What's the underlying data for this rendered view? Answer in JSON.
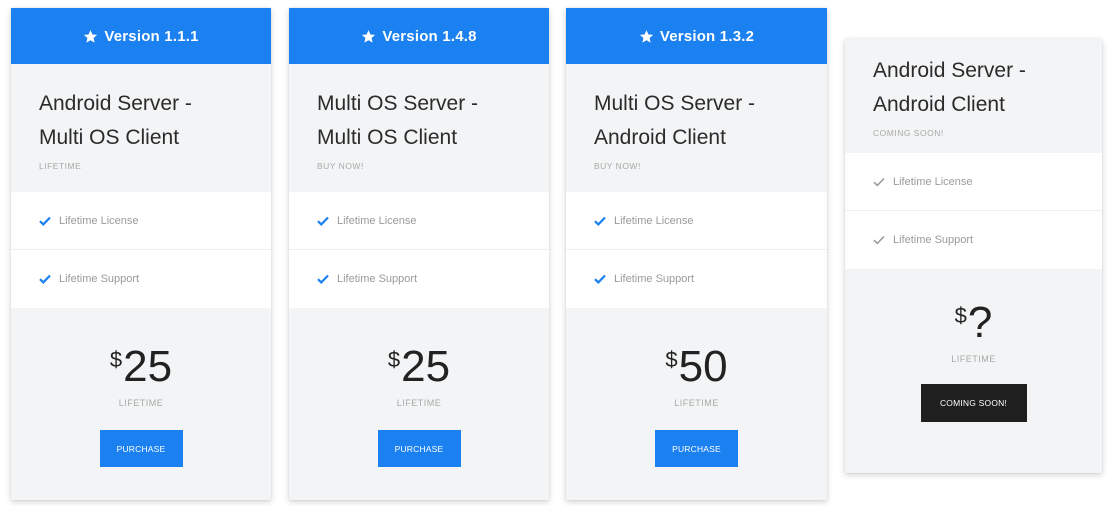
{
  "colors": {
    "accent": "#1b80f0",
    "dark_button": "#1f1f1f",
    "panel_bg": "#f3f4f5"
  },
  "icons": {
    "header_icon": "star-icon",
    "feature_icon": "check-icon"
  },
  "cards": [
    {
      "version": "Version 1.1.1",
      "title_line1": "Android Server -",
      "title_line2": "Multi OS Client",
      "subtitle": "LIFETIME",
      "features": [
        "Lifetime License",
        "Lifetime Support"
      ],
      "currency": "$",
      "price": "25",
      "period": "LIFETIME",
      "button": "PURCHASE"
    },
    {
      "version": "Version 1.4.8",
      "title_line1": "Multi OS Server -",
      "title_line2": "Multi OS Client",
      "subtitle": "BUY NOW!",
      "features": [
        "Lifetime License",
        "Lifetime Support"
      ],
      "currency": "$",
      "price": "25",
      "period": "LIFETIME",
      "button": "PURCHASE"
    },
    {
      "version": "Version 1.3.2",
      "title_line1": "Multi OS Server -",
      "title_line2": "Android Client",
      "subtitle": "BUY NOW!",
      "features": [
        "Lifetime License",
        "Lifetime Support"
      ],
      "currency": "$",
      "price": "50",
      "period": "LIFETIME",
      "button": "PURCHASE"
    },
    {
      "title_line1": "Android Server -",
      "title_line2": "Android Client",
      "subtitle": "COMING SOON!",
      "features": [
        "Lifetime License",
        "Lifetime Support"
      ],
      "currency": "$",
      "price": "?",
      "period": "LIFETIME",
      "button": "COMING SOON!"
    }
  ]
}
